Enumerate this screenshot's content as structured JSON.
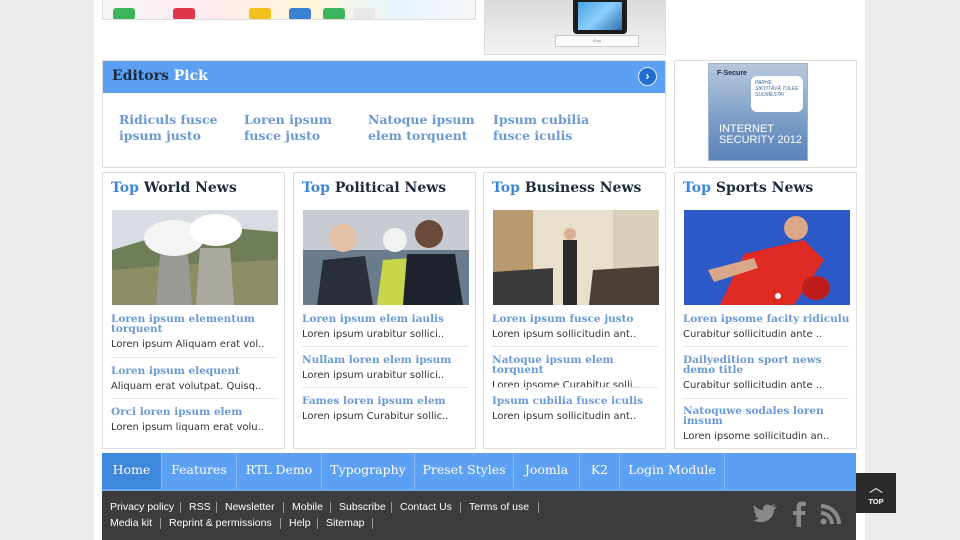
{
  "editors_pick": {
    "title_main": "Editors",
    "title_accent": "Pick",
    "items": [
      "Ridiculs fusce ipsum justo",
      "Loren ipsum fusce justo",
      "Natoque ipsum elem torquent",
      "Ipsum cubilia fusce iculis"
    ]
  },
  "advert": {
    "brand": "F-Secure",
    "bubble": "PARHE SIKYITÄVÄ TULEE SUOMESTA!",
    "product": "INTERNET SECURITY 2012"
  },
  "top_ipad": {
    "dock_label": "iPad"
  },
  "news": [
    {
      "accent": "Top",
      "title": "World News",
      "items": [
        {
          "link": "Loren ipsum elementum torquent",
          "desc": "Loren ipsum Aliquam erat vol.."
        },
        {
          "link": "Loren ipsum elequent",
          "desc": "Aliquam erat volutpat. Quisq.."
        },
        {
          "link": "Orci loren ipsum elem",
          "desc": "Loren ipsum liquam erat volu.."
        }
      ]
    },
    {
      "accent": "Top",
      "title": "Political News",
      "items": [
        {
          "link": "Loren ipsum elem iaulis",
          "desc": "Loren ipsum urabitur sollici.."
        },
        {
          "link": "Nullam loren elem ipsum",
          "desc": "Loren ipsum urabitur sollici.."
        },
        {
          "link": "Fames loren ipsum elem",
          "desc": "Loren ipsum Curabitur sollic.."
        }
      ]
    },
    {
      "accent": "Top",
      "title": "Business News",
      "items": [
        {
          "link": "Loren ipsum fusce justo",
          "desc": "Loren ipsum sollicitudin ant.."
        },
        {
          "link": "Natoque ipsum elem torquent",
          "desc": "Loren ipsome Curabitur solli.."
        },
        {
          "link": "Ipsum cubilia fusce iculis",
          "desc": "Loren ipsum sollicitudin ant.."
        }
      ]
    },
    {
      "accent": "Top",
      "title": "Sports News",
      "items": [
        {
          "link": "Loren ipsome facity ridiculu",
          "desc": "Curabitur sollicitudin ante .."
        },
        {
          "link": "Dailyedition sport news demo title",
          "desc": "Curabitur sollicitudin ante .."
        },
        {
          "link": "Natoquwe sodales loren imsum",
          "desc": "Loren ipsome sollicitudin an.."
        }
      ]
    }
  ],
  "nav": [
    "Home",
    "Features",
    "RTL Demo",
    "Typography",
    "Preset Styles",
    "Joomla",
    "K2",
    "Login Module"
  ],
  "footer": {
    "row1": [
      "Privacy policy",
      "RSS",
      "Newsletter",
      "Mobile",
      "Subscribe",
      "Contact Us",
      "Terms of use"
    ],
    "row2": [
      "Media kit",
      "Reprint & permissions",
      "Help",
      "Sitemap"
    ]
  },
  "social_icons": [
    "twitter-icon",
    "facebook-icon",
    "rss-icon"
  ],
  "back_to_top": "TOP",
  "colors": {
    "accent_blue": "#5ba0f2",
    "link_blue": "#6a9ad4",
    "footer_bg": "#3c3c3c"
  }
}
